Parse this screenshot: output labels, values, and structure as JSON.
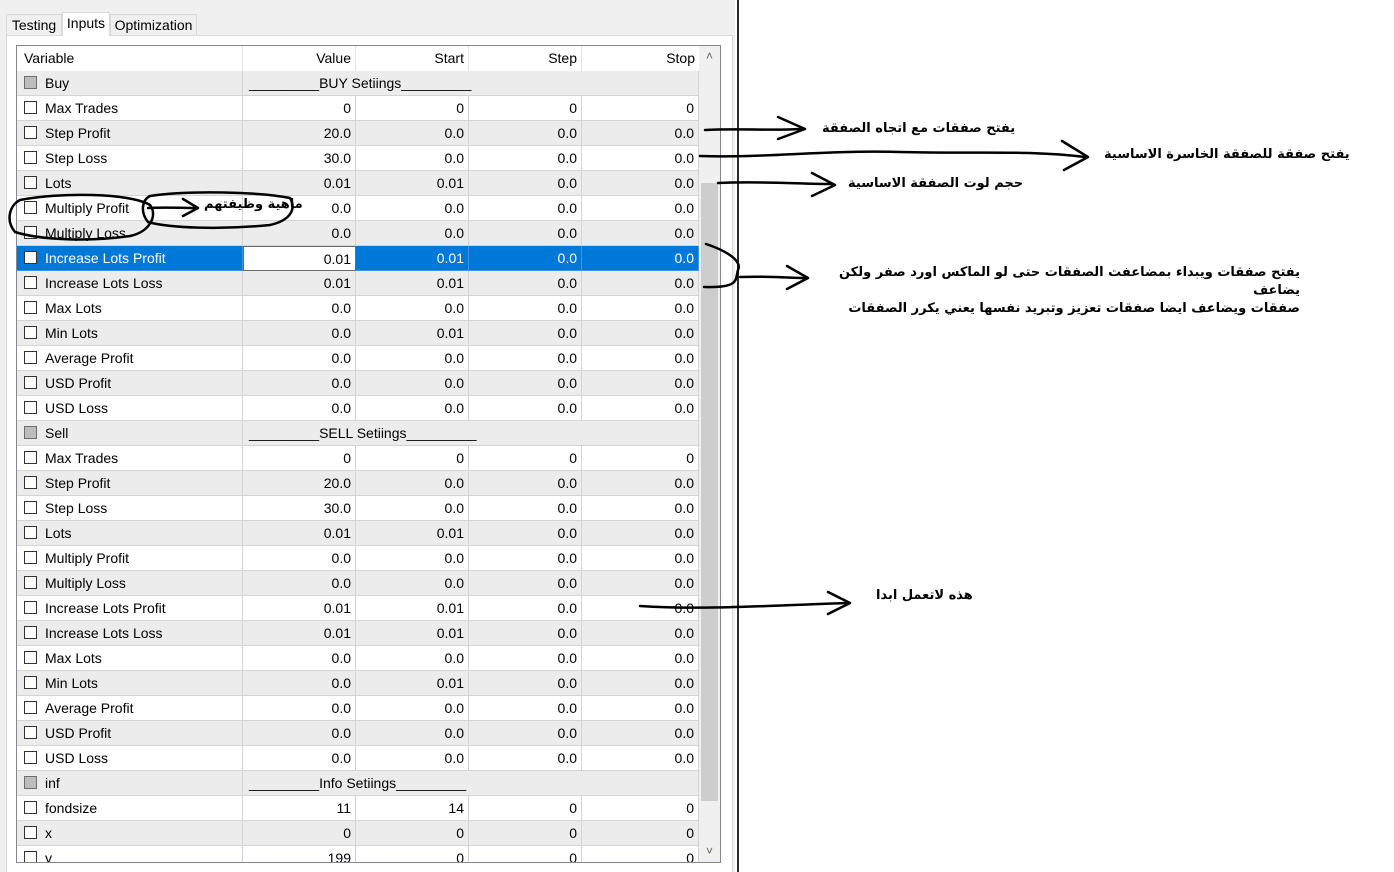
{
  "tabs": [
    {
      "label": "Testing",
      "active": false
    },
    {
      "label": "Inputs",
      "active": true
    },
    {
      "label": "Optimization",
      "active": false
    }
  ],
  "columns": {
    "variable": "Variable",
    "value": "Value",
    "start": "Start",
    "step": "Step",
    "stop": "Stop"
  },
  "rows": [
    {
      "name": "Buy",
      "group": true,
      "value": "_________BUY Setiings_________",
      "start": "",
      "step": "",
      "stop": ""
    },
    {
      "name": "Max Trades",
      "value": "0",
      "start": "0",
      "step": "0",
      "stop": "0"
    },
    {
      "name": "Step Profit",
      "value": "20.0",
      "start": "0.0",
      "step": "0.0",
      "stop": "0.0"
    },
    {
      "name": "Step Loss",
      "value": "30.0",
      "start": "0.0",
      "step": "0.0",
      "stop": "0.0"
    },
    {
      "name": "Lots",
      "value": "0.01",
      "start": "0.01",
      "step": "0.0",
      "stop": "0.0"
    },
    {
      "name": "Multiply Profit",
      "value": "0.0",
      "start": "0.0",
      "step": "0.0",
      "stop": "0.0"
    },
    {
      "name": "Multiply Loss",
      "value": "0.0",
      "start": "0.0",
      "step": "0.0",
      "stop": "0.0"
    },
    {
      "name": "Increase Lots Profit",
      "value": "0.01",
      "start": "0.01",
      "step": "0.0",
      "stop": "0.0",
      "selected": true
    },
    {
      "name": "Increase Lots Loss",
      "value": "0.01",
      "start": "0.01",
      "step": "0.0",
      "stop": "0.0"
    },
    {
      "name": "Max Lots",
      "value": "0.0",
      "start": "0.0",
      "step": "0.0",
      "stop": "0.0"
    },
    {
      "name": "Min Lots",
      "value": "0.0",
      "start": "0.01",
      "step": "0.0",
      "stop": "0.0"
    },
    {
      "name": "Average Profit",
      "value": "0.0",
      "start": "0.0",
      "step": "0.0",
      "stop": "0.0"
    },
    {
      "name": "USD Profit",
      "value": "0.0",
      "start": "0.0",
      "step": "0.0",
      "stop": "0.0"
    },
    {
      "name": "USD Loss",
      "value": "0.0",
      "start": "0.0",
      "step": "0.0",
      "stop": "0.0"
    },
    {
      "name": "Sell",
      "group": true,
      "value": "_________SELL Setiings_________",
      "start": "",
      "step": "",
      "stop": ""
    },
    {
      "name": "Max Trades",
      "value": "0",
      "start": "0",
      "step": "0",
      "stop": "0"
    },
    {
      "name": "Step Profit",
      "value": "20.0",
      "start": "0.0",
      "step": "0.0",
      "stop": "0.0"
    },
    {
      "name": "Step Loss",
      "value": "30.0",
      "start": "0.0",
      "step": "0.0",
      "stop": "0.0"
    },
    {
      "name": "Lots",
      "value": "0.01",
      "start": "0.01",
      "step": "0.0",
      "stop": "0.0"
    },
    {
      "name": "Multiply Profit",
      "value": "0.0",
      "start": "0.0",
      "step": "0.0",
      "stop": "0.0"
    },
    {
      "name": "Multiply Loss",
      "value": "0.0",
      "start": "0.0",
      "step": "0.0",
      "stop": "0.0"
    },
    {
      "name": "Increase Lots Profit",
      "value": "0.01",
      "start": "0.01",
      "step": "0.0",
      "stop": "0.0"
    },
    {
      "name": "Increase Lots Loss",
      "value": "0.01",
      "start": "0.01",
      "step": "0.0",
      "stop": "0.0"
    },
    {
      "name": "Max Lots",
      "value": "0.0",
      "start": "0.0",
      "step": "0.0",
      "stop": "0.0"
    },
    {
      "name": "Min Lots",
      "value": "0.0",
      "start": "0.01",
      "step": "0.0",
      "stop": "0.0"
    },
    {
      "name": "Average Profit",
      "value": "0.0",
      "start": "0.0",
      "step": "0.0",
      "stop": "0.0"
    },
    {
      "name": "USD Profit",
      "value": "0.0",
      "start": "0.0",
      "step": "0.0",
      "stop": "0.0"
    },
    {
      "name": "USD Loss",
      "value": "0.0",
      "start": "0.0",
      "step": "0.0",
      "stop": "0.0"
    },
    {
      "name": "inf",
      "group": true,
      "value": "_________Info Setiings_________",
      "start": "",
      "step": "",
      "stop": ""
    },
    {
      "name": "fondsize",
      "value": "11",
      "start": "14",
      "step": "0",
      "stop": "0"
    },
    {
      "name": "x",
      "value": "0",
      "start": "0",
      "step": "0",
      "stop": "0"
    },
    {
      "name": "y",
      "value": "199",
      "start": "0",
      "step": "0",
      "stop": "0"
    }
  ],
  "scrollbar": {
    "up_icon": "chevron-up-icon",
    "down_icon": "chevron-down-icon"
  },
  "annotations": {
    "step_profit": "يفتح صفقات مع اتجاه الصفقة",
    "step_loss": "يفتح صفقة للصفقة الخاسرة الاساسية",
    "lots": "حجم لوت الصفقة الاساسية",
    "multiply": "ماهية وظيفتهم",
    "increase_line1": "يفتح صفقات ويبداء بمضاعفت الصفقات  حتى لو الماكس اورد صفر ولكن يضاعف",
    "increase_line2": "صفقات ويضاعف ايضا صفقات تعزيز وتبريد نفسها يعني يكرر الصفقات",
    "not_working": "هذه لاتعمل ابدا"
  }
}
